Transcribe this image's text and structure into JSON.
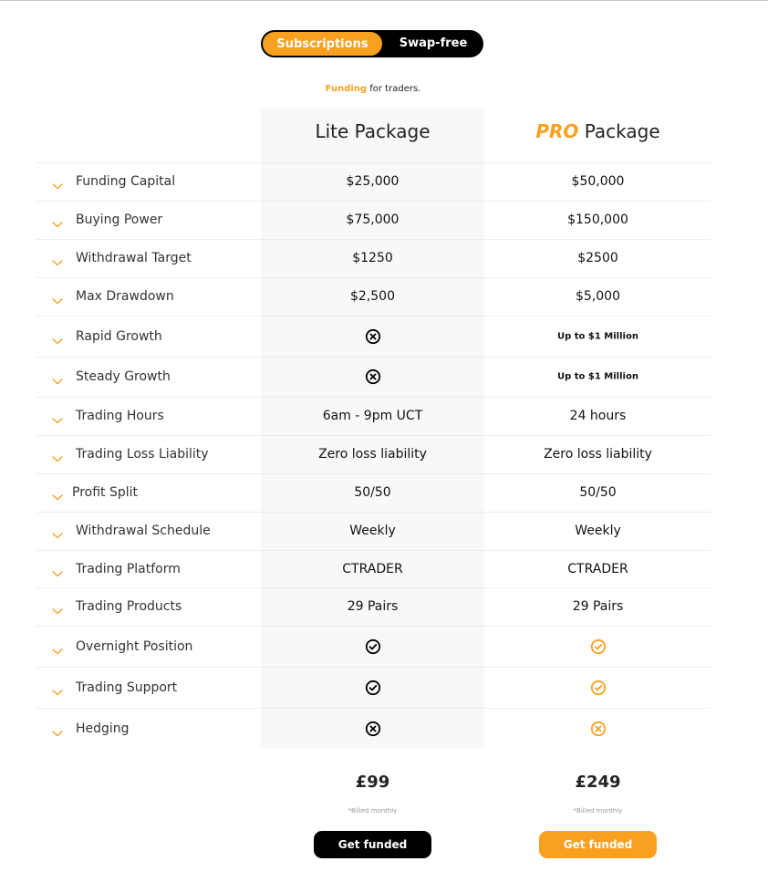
{
  "toggle": {
    "options": [
      "Subscriptions",
      "Swap-free"
    ],
    "active": "Subscriptions"
  },
  "tagline": {
    "highlight": "Funding",
    "rest": " for traders."
  },
  "packages": {
    "lite": {
      "title": "Lite Package"
    },
    "pro": {
      "title_accent": "PRO",
      "title_rest": " Package"
    }
  },
  "rows": [
    {
      "label": "Funding Capital",
      "lite": "$25,000",
      "pro": "$50,000"
    },
    {
      "label": "Buying Power",
      "lite": "$75,000",
      "pro": "$150,000"
    },
    {
      "label": "Withdrawal Target",
      "lite": "$1250",
      "pro": "$2500"
    },
    {
      "label": "Max Drawdown",
      "lite": "$2,500",
      "pro": "$5,000"
    },
    {
      "label": "Rapid Growth",
      "lite_icon": "x-circle-icon",
      "pro": "Up to $1 Million"
    },
    {
      "label": "Steady Growth",
      "lite_icon": "x-circle-icon",
      "pro": "Up to $1 Million"
    },
    {
      "label": "Trading Hours",
      "lite": "6am - 9pm UCT",
      "pro": "24 hours"
    },
    {
      "label": "Trading Loss Liability",
      "lite": "Zero loss liability",
      "pro": "Zero loss liability"
    },
    {
      "label": "Profit Split",
      "lite": "50/50",
      "pro": "50/50"
    },
    {
      "label": "Withdrawal Schedule",
      "lite": "Weekly",
      "pro": "Weekly"
    },
    {
      "label": "Trading Platform",
      "lite": "CTRADER",
      "pro": "CTRADER"
    },
    {
      "label": "Trading Products",
      "lite": "29 Pairs",
      "pro": "29 Pairs"
    },
    {
      "label": "Overnight Position",
      "lite_icon": "check-circle-icon",
      "pro_icon": "check-circle-icon"
    },
    {
      "label": "Trading Support",
      "lite_icon": "check-circle-icon",
      "pro_icon": "check-circle-icon"
    },
    {
      "label": "Hedging",
      "lite_icon": "x-circle-icon",
      "pro_icon": "x-circle-icon"
    }
  ],
  "pricing": {
    "lite": {
      "price": "£99",
      "billed": "*Billed monthly",
      "button": "Get funded"
    },
    "pro": {
      "price": "£249",
      "billed": "*Billed monthly",
      "button": "Get funded"
    }
  },
  "colors": {
    "accent": "#f9a021",
    "dark": "#000000",
    "lite_column_bg": "#f8f8f8",
    "row_divider": "#ececec"
  }
}
